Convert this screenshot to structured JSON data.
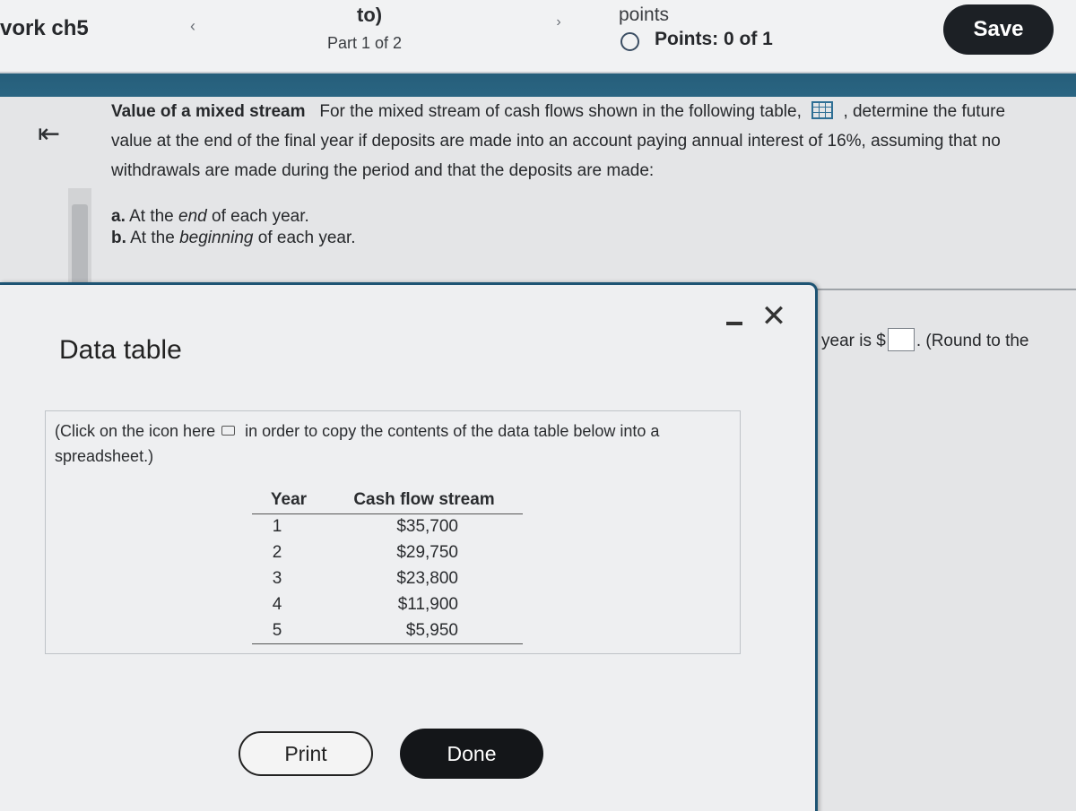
{
  "header": {
    "homework_title": "vork ch5",
    "question_title": "to)",
    "part_label": "Part 1 of 2",
    "points_label": "points",
    "points_status": "Points: 0 of 1",
    "save_label": "Save",
    "prev_icon": "chevron-left-icon",
    "next_icon": "chevron-right-icon"
  },
  "question": {
    "title": "Value of a mixed stream",
    "text_before_icon": "For the mixed stream of cash flows shown in the following table,",
    "text_after_icon": ", determine the future value at the end of the final year if deposits are made into an account paying annual interest of 16%, assuming that no withdrawals are made during the period and that the deposits are made:",
    "part_a_label": "a.",
    "part_a_pre": "At the",
    "part_a_em": "end",
    "part_a_post": "of each year.",
    "part_b_label": "b.",
    "part_b_pre": "At the",
    "part_b_em": "beginning",
    "part_b_post": "of each year."
  },
  "answer_area": {
    "text_before": "year is $",
    "text_after": ". (Round to the"
  },
  "data_table": {
    "title": "Data table",
    "copy_note_before": "(Click on the icon here",
    "copy_note_after": "in order to copy the contents of the data table below into a spreadsheet.)",
    "col_year": "Year",
    "col_flow": "Cash flow stream",
    "rows": [
      {
        "year": "1",
        "flow": "$35,700"
      },
      {
        "year": "2",
        "flow": "$29,750"
      },
      {
        "year": "3",
        "flow": "$23,800"
      },
      {
        "year": "4",
        "flow": "$11,900"
      },
      {
        "year": "5",
        "flow": "$5,950"
      }
    ],
    "print_label": "Print",
    "done_label": "Done"
  },
  "colors": {
    "header_blue": "#235a76",
    "button_dark": "#1c2025"
  }
}
